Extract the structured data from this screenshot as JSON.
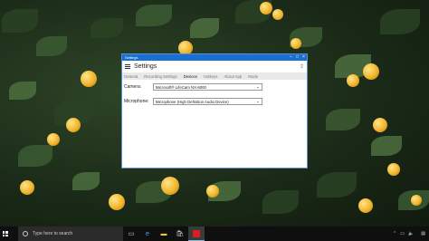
{
  "window": {
    "title": "Settings",
    "app_title": "Settings",
    "minimize": "–",
    "maximize": "□",
    "close": "×",
    "tabs": [
      {
        "label": "General",
        "active": false
      },
      {
        "label": "Recording Settings",
        "active": false
      },
      {
        "label": "Devices",
        "active": true
      },
      {
        "label": "Hotkeys",
        "active": false
      },
      {
        "label": "About App",
        "active": false
      },
      {
        "label": "Mode",
        "active": false
      }
    ],
    "camera": {
      "label": "Camera:",
      "value": "Microsoft® LifeCam NX-6000"
    },
    "microphone": {
      "label": "Microphone:",
      "value": "Microphone (High Definition Audio Device)"
    }
  },
  "taskbar": {
    "search_placeholder": "Type here to search",
    "time": "",
    "date": ""
  },
  "colors": {
    "accent": "#1a6fd4",
    "taskbar": "#0f0f0f"
  }
}
